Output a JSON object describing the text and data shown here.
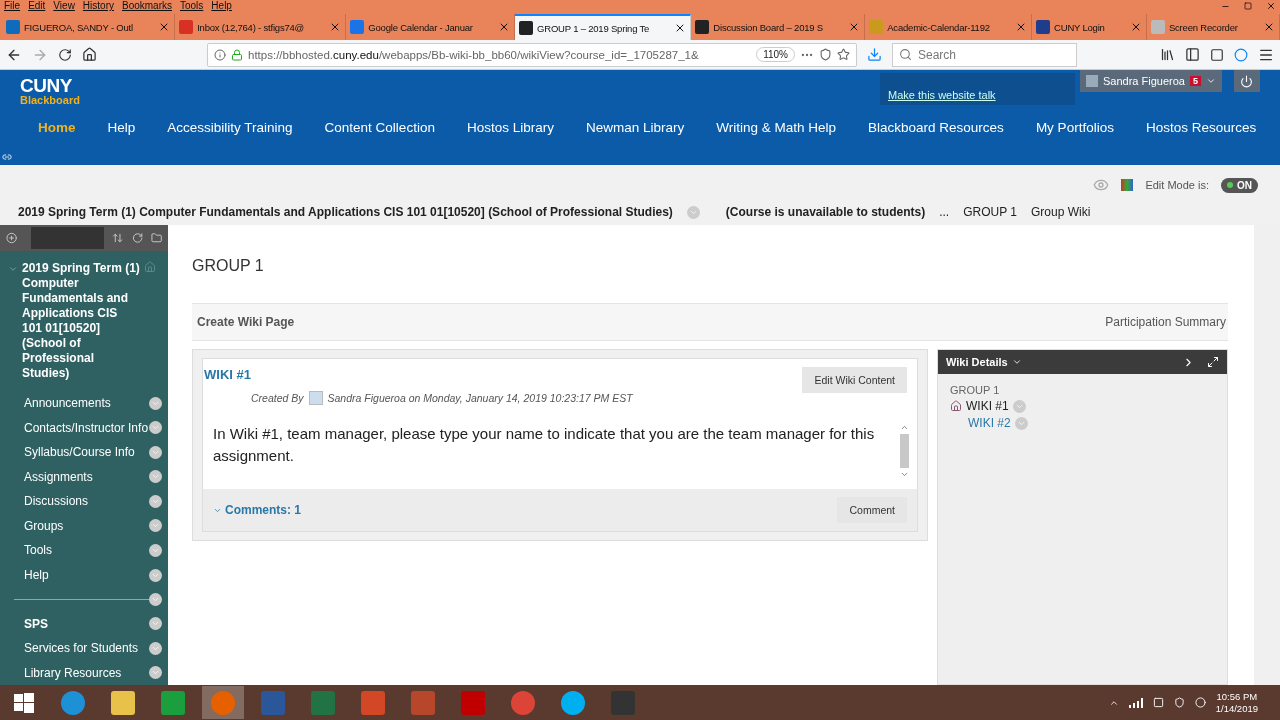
{
  "menu_bar": [
    "File",
    "Edit",
    "View",
    "History",
    "Bookmarks",
    "Tools",
    "Help"
  ],
  "browser_tabs": [
    {
      "title": "FIGUEROA, SANDY - Outl",
      "color": "#0f6cbd",
      "selected": false
    },
    {
      "title": "Inbox (12,764) - stfigs74@",
      "color": "#d93025",
      "selected": false
    },
    {
      "title": "Google Calendar - Januar",
      "color": "#1a73e8",
      "selected": false
    },
    {
      "title": "GROUP 1 – 2019 Spring Te",
      "color": "#222222",
      "selected": true
    },
    {
      "title": "Discussion Board – 2019 S",
      "color": "#222222",
      "selected": false
    },
    {
      "title": "Academic-Calendar-1192",
      "color": "#c99a1c",
      "selected": false
    },
    {
      "title": "CUNY Login",
      "color": "#1f3d8a",
      "selected": false
    },
    {
      "title": "Screen Recorder",
      "color": "#bbbbbb",
      "selected": false
    }
  ],
  "address_bar": {
    "url_prefix": "https://bbhosted.",
    "url_domain": "cuny.edu",
    "url_rest": "/webapps/Bb-wiki-bb_bb60/wikiView?course_id=_1705287_1&",
    "zoom": "110%"
  },
  "search": {
    "placeholder": "Search"
  },
  "logo": {
    "line1": "CUNY",
    "line2": "Blackboard"
  },
  "talk_link": "Make this website talk",
  "user": {
    "name": "Sandra Figueroa",
    "notifications": "5"
  },
  "nav_items": [
    {
      "label": "Home",
      "selected": true
    },
    {
      "label": "Help",
      "selected": false
    },
    {
      "label": "Accessibility Training",
      "selected": false
    },
    {
      "label": "Content Collection",
      "selected": false
    },
    {
      "label": "Hostos Library",
      "selected": false
    },
    {
      "label": "Newman Library",
      "selected": false
    },
    {
      "label": "Writing & Math Help",
      "selected": false
    },
    {
      "label": "Blackboard Resources",
      "selected": false
    },
    {
      "label": "My Portfolios",
      "selected": false
    },
    {
      "label": "Hostos Resources",
      "selected": false
    }
  ],
  "edit_mode": {
    "label": "Edit Mode is:",
    "on": true,
    "text": "ON"
  },
  "breadcrumbs": {
    "course": "2019 Spring Term (1) Computer Fundamentals and Applications CIS 101 01[10520] (School of Professional Studies)",
    "notice": "(Course is unavailable to students)",
    "ellipsis": "...",
    "items": [
      "GROUP 1",
      "Group Wiki"
    ]
  },
  "sidebar": {
    "course_title": "2019 Spring Term (1) Computer Fundamentals and Applications CIS 101 01[10520] (School of Professional Studies)",
    "items": [
      {
        "kind": "link",
        "label": "Announcements"
      },
      {
        "kind": "link",
        "label": "Contacts/Instructor Info"
      },
      {
        "kind": "link",
        "label": "Syllabus/Course Info"
      },
      {
        "kind": "link",
        "label": "Assignments"
      },
      {
        "kind": "link",
        "label": "Discussions"
      },
      {
        "kind": "link",
        "label": "Groups"
      },
      {
        "kind": "link",
        "label": "Tools"
      },
      {
        "kind": "link",
        "label": "Help"
      },
      {
        "kind": "divider"
      },
      {
        "kind": "heading",
        "label": "SPS"
      },
      {
        "kind": "link",
        "label": "Services for Students"
      },
      {
        "kind": "link",
        "label": "Library Resources"
      }
    ]
  },
  "page_title": "GROUP 1",
  "action_bar": {
    "create": "Create Wiki Page",
    "summary": "Participation Summary"
  },
  "wiki": {
    "title": "WIKI #1",
    "created_by": "Created By",
    "author_line": "Sandra Figueroa on Monday, January 14, 2019 10:23:17 PM EST",
    "edit_button": "Edit Wiki Content",
    "body": "In Wiki #1, team manager, please type your name to indicate that you are the team manager for this assignment.",
    "comments": "Comments: 1",
    "comment_button": "Comment"
  },
  "details": {
    "title": "Wiki Details",
    "group": "GROUP 1",
    "pages": [
      {
        "label": "WIKI #1",
        "selected": true
      },
      {
        "label": "WIKI #2",
        "selected": false
      }
    ]
  },
  "taskbar": {
    "apps": [
      {
        "kind": "browser-e",
        "color": "#1e90d6",
        "selected": false
      },
      {
        "kind": "folder",
        "color": "#e8c14a",
        "selected": false
      },
      {
        "kind": "store",
        "color": "#1b9e3e",
        "selected": false
      },
      {
        "kind": "fox",
        "color": "#e66000",
        "selected": true
      },
      {
        "kind": "doc",
        "color": "#2b579a",
        "selected": false
      },
      {
        "kind": "doc",
        "color": "#217346",
        "selected": false
      },
      {
        "kind": "doc",
        "color": "#d24726",
        "selected": false
      },
      {
        "kind": "doc",
        "color": "#b7472a",
        "selected": false
      },
      {
        "kind": "doc",
        "color": "#c00000",
        "selected": false
      },
      {
        "kind": "chrome",
        "color": "#db4437",
        "selected": false
      },
      {
        "kind": "chat",
        "color": "#00aff0",
        "selected": false
      },
      {
        "kind": "snip",
        "color": "#333333",
        "selected": false
      }
    ],
    "time": "10:56 PM",
    "date": "1/14/2019"
  }
}
